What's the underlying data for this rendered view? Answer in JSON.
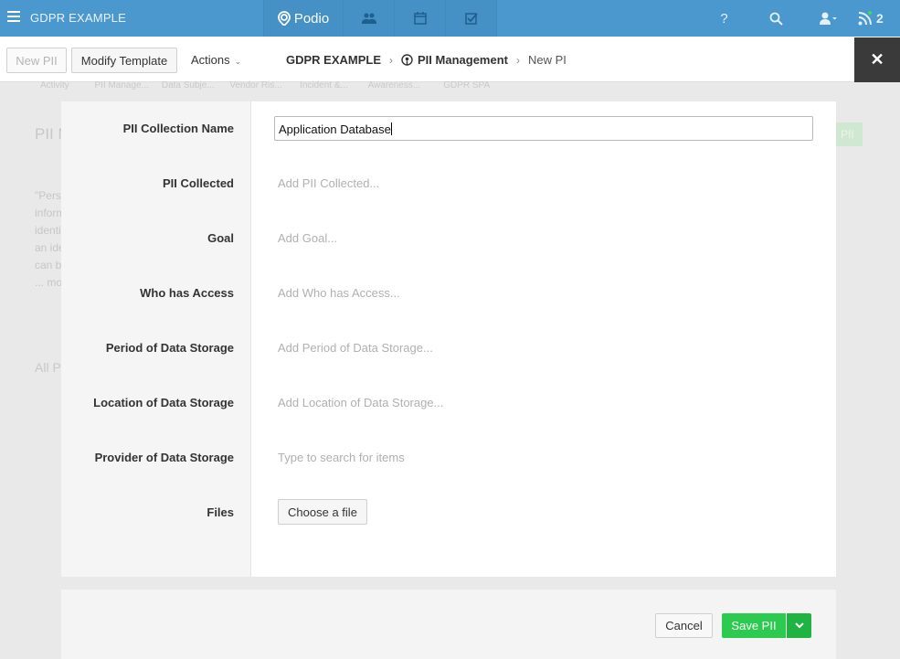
{
  "topbar": {
    "workspace_name": "GDPR EXAMPLE",
    "logo_text": "Podio",
    "help_label": "?",
    "notification_count": "2",
    "accent_color": "#4a98cd"
  },
  "toolbar": {
    "new_label": "New PII",
    "modify_label": "Modify Template",
    "actions_label": "Actions",
    "breadcrumb": {
      "workspace": "GDPR EXAMPLE",
      "app": "PII Management",
      "current": "New PI"
    }
  },
  "background": {
    "tabs": [
      "Activity",
      "PII Manage...",
      "Data Subje...",
      "Vendor Ris...",
      "Incident &...",
      "Awareness...",
      "GDPR SPA"
    ],
    "title": "PII M",
    "text_lines": [
      "\"Pers",
      "inform",
      "identi",
      "an ide",
      "can b",
      "... mo"
    ],
    "all_label": "All P",
    "green_button_label": "PII"
  },
  "form": {
    "fields": [
      {
        "label": "PII Collection Name",
        "value": "Application Database"
      },
      {
        "label": "PII Collected",
        "placeholder": "Add PII Collected..."
      },
      {
        "label": "Goal",
        "placeholder": "Add Goal..."
      },
      {
        "label": "Who has Access",
        "placeholder": "Add Who has Access..."
      },
      {
        "label": "Period of Data Storage",
        "placeholder": "Add Period of Data Storage..."
      },
      {
        "label": "Location of Data Storage",
        "placeholder": "Add Location of Data Storage..."
      },
      {
        "label": "Provider of Data Storage",
        "placeholder": "Type to search for items"
      },
      {
        "label": "Files",
        "button": "Choose a file"
      }
    ]
  },
  "footer": {
    "cancel_label": "Cancel",
    "save_label": "Save PII",
    "save_color": "#2ccb4f"
  }
}
